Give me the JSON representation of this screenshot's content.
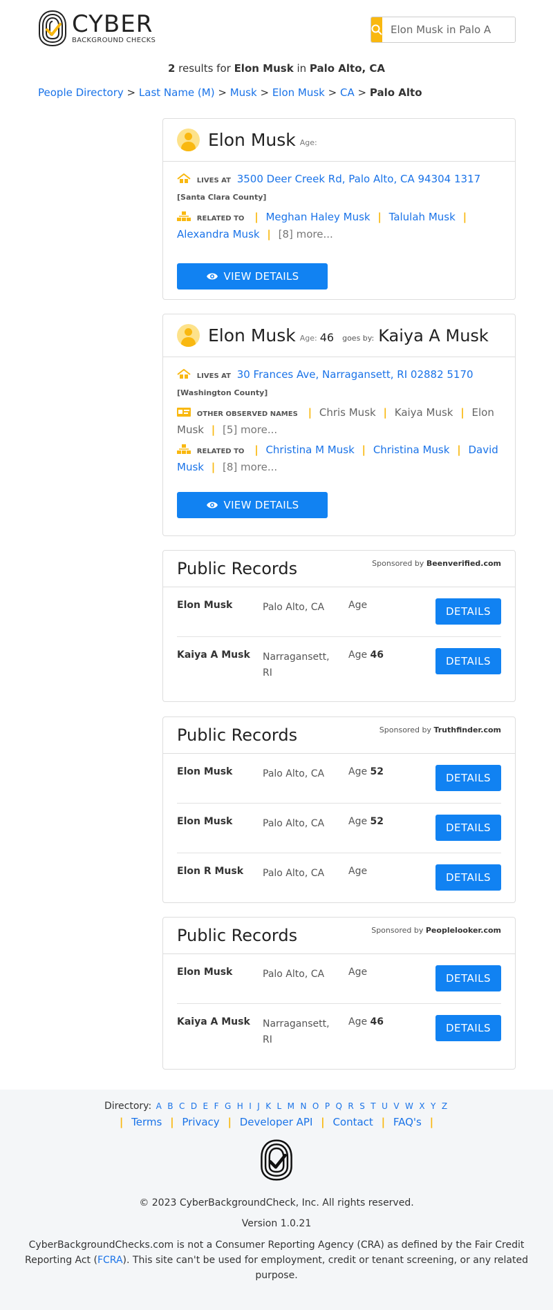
{
  "header": {
    "logo_big": "CYBER",
    "logo_small": "BACKGROUND CHECKS",
    "search_value": "Elon Musk in Palo A"
  },
  "results": {
    "count": "2",
    "text1": " results for ",
    "name": "Elon Musk",
    "text2": " in ",
    "place": "Palo Alto, CA"
  },
  "breadcrumb": {
    "items": [
      "People Directory",
      "Last Name (M)",
      "Musk",
      "Elon Musk",
      "CA"
    ],
    "current": "Palo Alto",
    "sep": ">"
  },
  "people": [
    {
      "name": "Elon Musk",
      "age_label": "Age:",
      "lives_label": "LIVES AT",
      "address": "3500 Deer Creek Rd, Palo Alto, CA 94304 1317",
      "county": "[Santa Clara County]",
      "related_label": "RELATED TO",
      "related": [
        "Meghan Haley Musk",
        "Talulah Musk",
        "Alexandra Musk"
      ],
      "related_more": "[8] more...",
      "button": "VIEW DETAILS"
    },
    {
      "name": "Elon Musk",
      "age_label": "Age:",
      "age": "46",
      "goes_label": "goes by:",
      "goes_name": "Kaiya A Musk",
      "lives_label": "LIVES AT",
      "address": "30 Frances Ave, Narragansett, RI 02882 5170",
      "county": "[Washington County]",
      "other_label": "OTHER OBSERVED NAMES",
      "other_names": [
        "Chris Musk",
        "Kaiya Musk",
        "Elon Musk"
      ],
      "other_more": "[5] more...",
      "related_label": "RELATED TO",
      "related": [
        "Christina M Musk",
        "Christina Musk",
        "David Musk"
      ],
      "related_more": "[8] more...",
      "button": "VIEW DETAILS"
    }
  ],
  "public_records": [
    {
      "title": "Public Records",
      "sponsor_label": "Sponsored by",
      "sponsor": "Beenverified.com",
      "rows": [
        {
          "name": "Elon Musk",
          "loc": "Palo Alto, CA",
          "age_label": "Age",
          "age": "",
          "button": "DETAILS"
        },
        {
          "name": "Kaiya A Musk",
          "loc": "Narragansett, RI",
          "age_label": "Age",
          "age": "46",
          "button": "DETAILS"
        }
      ]
    },
    {
      "title": "Public Records",
      "sponsor_label": "Sponsored by",
      "sponsor": "Truthfinder.com",
      "rows": [
        {
          "name": "Elon Musk",
          "loc": "Palo Alto, CA",
          "age_label": "Age",
          "age": "52",
          "button": "DETAILS"
        },
        {
          "name": "Elon Musk",
          "loc": "Palo Alto, CA",
          "age_label": "Age",
          "age": "52",
          "button": "DETAILS"
        },
        {
          "name": "Elon R Musk",
          "loc": "Palo Alto, CA",
          "age_label": "Age",
          "age": "",
          "button": "DETAILS"
        }
      ]
    },
    {
      "title": "Public Records",
      "sponsor_label": "Sponsored by",
      "sponsor": "Peoplelooker.com",
      "rows": [
        {
          "name": "Elon Musk",
          "loc": "Palo Alto, CA",
          "age_label": "Age",
          "age": "",
          "button": "DETAILS"
        },
        {
          "name": "Kaiya A Musk",
          "loc": "Narragansett, RI",
          "age_label": "Age",
          "age": "46",
          "button": "DETAILS"
        }
      ]
    }
  ],
  "footer": {
    "directory_label": "Directory:",
    "letters": [
      "A",
      "B",
      "C",
      "D",
      "E",
      "F",
      "G",
      "H",
      "I",
      "J",
      "K",
      "L",
      "M",
      "N",
      "O",
      "P",
      "Q",
      "R",
      "S",
      "T",
      "U",
      "V",
      "W",
      "X",
      "Y",
      "Z"
    ],
    "links": [
      "Terms",
      "Privacy",
      "Developer API",
      "Contact",
      "FAQ's"
    ],
    "copyright": "© 2023 CyberBackgroundCheck, Inc. All rights reserved.",
    "version": "Version 1.0.21",
    "disclaimer_1": "CyberBackgroundChecks.com is not a Consumer Reporting Agency (CRA) as defined by the Fair Credit Reporting Act (",
    "disclaimer_link": "FCRA",
    "disclaimer_2": "). This site can't be used for employment, credit or tenant screening, or any related purpose."
  },
  "colors": {
    "accent": "#f9b810",
    "primary_button": "#1182f2",
    "link": "#1a73e8"
  }
}
